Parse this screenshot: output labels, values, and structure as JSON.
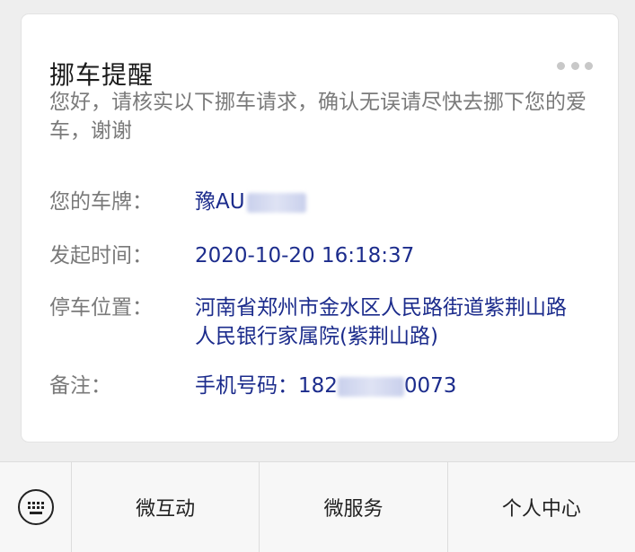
{
  "card": {
    "title": "挪车提醒",
    "intro": "您好，请核实以下挪车请求，确认无误请尽快去挪下您的爱车，谢谢",
    "fields": [
      {
        "label": "您的车牌：",
        "value": "豫AU",
        "masked_tail": ""
      },
      {
        "label": "发起时间：",
        "value": "2020-10-20 16:18:37"
      },
      {
        "label": "停车位置：",
        "value": "河南省郑州市金水区人民路街道紫荆山路人民银行家属院(紫荆山路)"
      },
      {
        "label": "备注：",
        "value_prefix": "手机号码：182",
        "value_suffix": "0073"
      }
    ]
  },
  "bottom_menu": {
    "items": [
      {
        "label": "微互动"
      },
      {
        "label": "微服务"
      },
      {
        "label": "个人中心"
      }
    ]
  }
}
